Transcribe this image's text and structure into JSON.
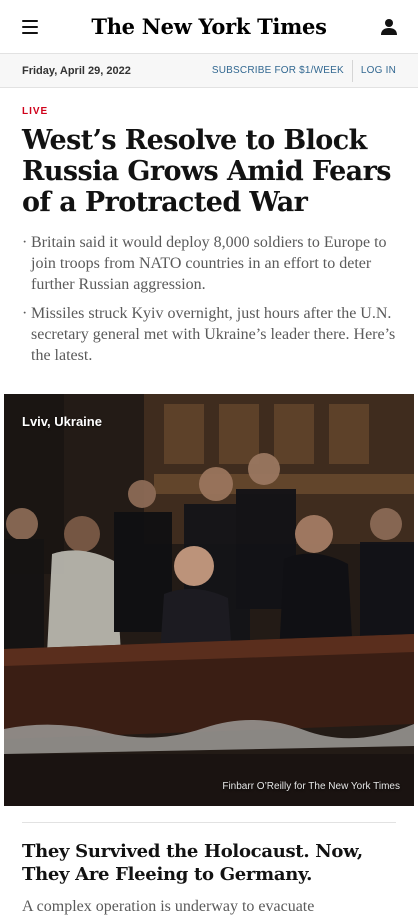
{
  "header": {
    "logo_text": "The New York Times",
    "menu_icon": "hamburger-menu-icon",
    "account_icon": "user-account-icon"
  },
  "datebar": {
    "date": "Friday, April 29, 2022",
    "subscribe": "SUBSCRIBE FOR $1/WEEK",
    "login": "LOG IN"
  },
  "lead_story": {
    "label": "LIVE",
    "headline": "West’s Resolve to Block Russia Grows Amid Fears of a Protracted War",
    "bullets": [
      "Britain said it would deploy 8,000 soldiers to Europe to join troops from NATO countries in an effort to deter further Russian aggression.",
      "Missiles struck Kyiv overnight, just hours after the U.N. secretary general met with Ukraine’s leader there. Here’s the latest."
    ],
    "bullet_symbol": "·",
    "photo": {
      "location": "Lviv, Ukraine",
      "credit": "Finbarr O’Reilly for The New York Times"
    }
  },
  "second_story": {
    "headline": "They Survived the Holocaust. Now, They Are Fleeing to Germany.",
    "summary": "A complex operation is underway to evacuate"
  },
  "colors": {
    "live_red": "#d0021b",
    "link_blue": "#326891",
    "text": "#121212",
    "summary_gray": "#5a5a5a"
  }
}
